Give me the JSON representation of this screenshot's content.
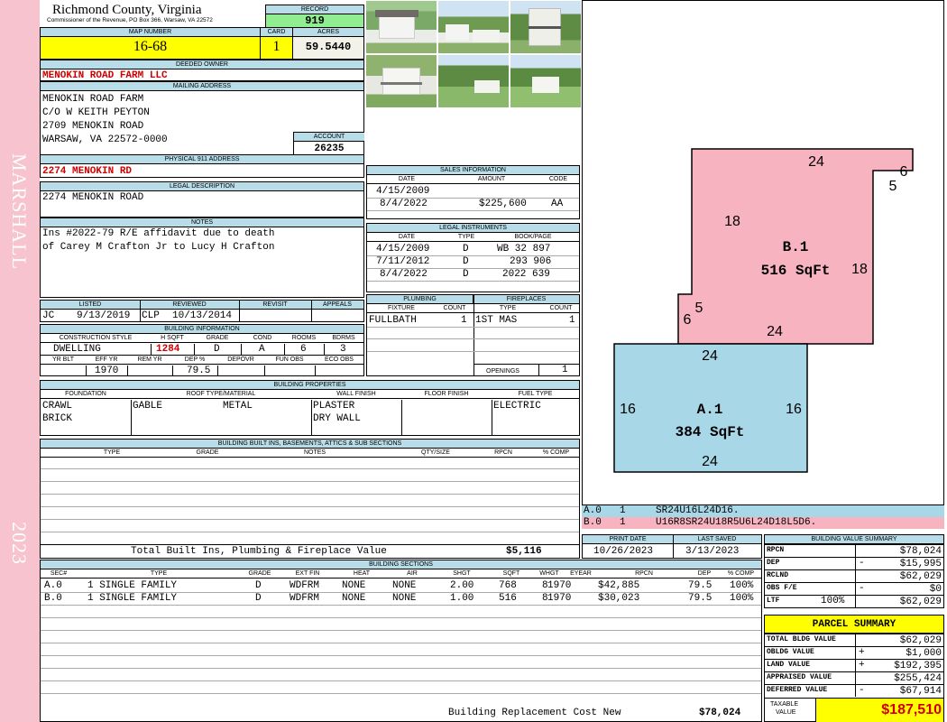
{
  "side": {
    "district": "MARSHALL",
    "year": "2023"
  },
  "header": {
    "county": "Richmond County, Virginia",
    "commissioner": "Commissioner of the Revenue, PO Box 366, Warsaw, VA 22572",
    "record_label": "RECORD",
    "record": "919",
    "map_label": "MAP NUMBER",
    "map": "16-68",
    "card_label": "CARD",
    "card": "1",
    "acres_label": "ACRES",
    "acres": "59.5440"
  },
  "owner": {
    "deeded_label": "DEEDED OWNER",
    "deeded": "MENOKIN ROAD FARM LLC",
    "mailing_label": "MAILING ADDRESS",
    "lines": [
      "MENOKIN ROAD FARM",
      "C/O W KEITH PEYTON",
      "2709 MENOKIN ROAD",
      "WARSAW, VA 22572-0000"
    ],
    "account_label": "ACCOUNT",
    "account": "26235"
  },
  "physical": {
    "label": "PHYSICAL 911 ADDRESS",
    "value": "2274 MENOKIN RD"
  },
  "legal": {
    "label": "LEGAL DESCRIPTION",
    "value": "2274 MENOKIN ROAD"
  },
  "notes": {
    "label": "NOTES",
    "lines": [
      "Ins #2022-79 R/E affidavit due to death",
      "of Carey M Crafton Jr to Lucy H Crafton"
    ]
  },
  "sales": {
    "label": "SALES INFORMATION",
    "cols": [
      "DATE",
      "AMOUNT",
      "CODE"
    ],
    "rows": [
      {
        "date": "4/15/2009",
        "amount": "",
        "code": ""
      },
      {
        "date": "8/4/2022",
        "amount": "$225,600",
        "code": "AA"
      }
    ]
  },
  "instruments": {
    "label": "LEGAL INSTRUMENTS",
    "cols": [
      "DATE",
      "TYPE",
      "BOOK/PAGE"
    ],
    "rows": [
      {
        "date": "4/15/2009",
        "type": "D",
        "book": "WB 32 897"
      },
      {
        "date": "7/11/2012",
        "type": "D",
        "book": "293 906"
      },
      {
        "date": "8/4/2022",
        "type": "D",
        "book": "2022 639"
      }
    ]
  },
  "review": {
    "cols": [
      "LISTED",
      "REVIEWED",
      "REVISIT",
      "APPEALS"
    ],
    "listed_by": "JC",
    "listed": "9/13/2019",
    "reviewed_by": "CLP",
    "reviewed": "10/13/2014"
  },
  "bldg_info": {
    "label": "BUILDING INFORMATION",
    "cols": [
      "CONSTRUCTION STYLE",
      "H SQFT",
      "GRADE",
      "COND",
      "ROOMS",
      "BDRMS"
    ],
    "style": "DWELLING",
    "hsqft": "1284",
    "grade": "D",
    "cond": "A",
    "rooms": "6",
    "bdrms": "3",
    "cols2": [
      "YR BLT",
      "EFF YR",
      "REM YR",
      "DEP %",
      "DEPOVR",
      "FUN OBS",
      "ECO OBS"
    ],
    "eff_yr": "1970",
    "dep": "79.5"
  },
  "plumbing": {
    "label": "PLUMBING",
    "cols": [
      "FIXTURE",
      "COUNT"
    ],
    "fixture": "FULLBATH",
    "count": "1"
  },
  "fireplaces": {
    "label": "FIREPLACES",
    "cols": [
      "TYPE",
      "COUNT"
    ],
    "type": "1ST MAS",
    "count": "1",
    "openings_label": "OPENINGS",
    "openings": "1"
  },
  "props": {
    "label": "BUILDING PROPERTIES",
    "cols": [
      "FOUNDATION",
      "ROOF TYPE/MATERIAL",
      "WALL FINISH",
      "FLOOR FINISH",
      "FUEL TYPE"
    ],
    "foundation": [
      "CRAWL",
      "BRICK"
    ],
    "roof_type": "GABLE",
    "roof_mat": "METAL",
    "wall": [
      "PLASTER",
      "DRY WALL"
    ],
    "fuel": "ELECTRIC"
  },
  "builtins": {
    "label": "BUILDING BUILT INS, BASEMENTS, ATTICS & SUB SECTIONS",
    "cols": [
      "TYPE",
      "GRADE",
      "NOTES",
      "QTY/SIZE",
      "RPCN",
      "% COMP"
    ],
    "total_label": "Total Built Ins, Plumbing & Fireplace Value",
    "total": "$5,116"
  },
  "sections": {
    "label": "BUILDING SECTIONS",
    "cols": [
      "SEC#",
      "TYPE",
      "GRADE",
      "EXT FIN",
      "HEAT",
      "AIR",
      "SHGT",
      "SQFT",
      "WHGT",
      "EYEAR",
      "RPCN",
      "DEP",
      "% COMP"
    ],
    "rows": [
      {
        "sec": "A.0",
        "type": "1 SINGLE FAMILY",
        "grade": "D",
        "ext": "WDFRM",
        "heat": "NONE",
        "air": "NONE",
        "shgt": "2.00",
        "sqft": "768",
        "whgt": "8",
        "eyear": "1970",
        "rpcn": "$42,885",
        "dep": "79.5",
        "comp": "100%"
      },
      {
        "sec": "B.0",
        "type": "1 SINGLE FAMILY",
        "grade": "D",
        "ext": "WDFRM",
        "heat": "NONE",
        "air": "NONE",
        "shgt": "1.00",
        "sqft": "516",
        "whgt": "8",
        "eyear": "1970",
        "rpcn": "$30,023",
        "dep": "79.5",
        "comp": "100%"
      }
    ],
    "replacement_label": "Building Replacement Cost New",
    "replacement": "$78,024"
  },
  "sketch": {
    "b_label": "B.1",
    "b_area": "516 SqFt",
    "a_label": "A.1",
    "a_area": "384 SqFt",
    "b_dims": [
      "24",
      "6",
      "5",
      "18",
      "18",
      "5",
      "6",
      "24"
    ],
    "a_dims": [
      "24",
      "16",
      "16",
      "24"
    ],
    "codes": [
      {
        "sec": "A.0",
        "n": "1",
        "code": "SR24U16L24D16."
      },
      {
        "sec": "B.0",
        "n": "1",
        "code": "U16R8SR24U18R5U6L24D18L5D6."
      }
    ]
  },
  "dates": {
    "print_label": "PRINT DATE",
    "print": "10/26/2023",
    "saved_label": "LAST SAVED",
    "saved": "3/13/2023"
  },
  "bvs": {
    "label": "BUILDING VALUE SUMMARY",
    "rows": [
      {
        "k": "RPCN",
        "s": "",
        "v": "$78,024"
      },
      {
        "k": "DEP",
        "s": "-",
        "v": "$15,995"
      },
      {
        "k": "RCLND",
        "s": "",
        "v": "$62,029"
      },
      {
        "k": "OBS F/E",
        "s": "-",
        "v": "$0"
      },
      {
        "k": "LTF",
        "s": "100%",
        "v": "$62,029"
      }
    ]
  },
  "parcel": {
    "label": "PARCEL SUMMARY",
    "rows": [
      {
        "k": "TOTAL BLDG VALUE",
        "s": "",
        "v": "$62,029"
      },
      {
        "k": "OBLDG VALUE",
        "s": "+",
        "v": "$1,000"
      },
      {
        "k": "LAND VALUE",
        "s": "+",
        "v": "$192,395"
      },
      {
        "k": "APPRAISED VALUE",
        "s": "",
        "v": "$255,424"
      },
      {
        "k": "DEFERRED VALUE",
        "s": "-",
        "v": "$67,914"
      }
    ],
    "taxable_label": [
      "TAXABLE",
      "VALUE"
    ],
    "taxable": "$187,510"
  },
  "colors": {
    "side": "#f7c3cf",
    "header": "#b8dde8",
    "yellow": "#ffff00",
    "green": "#90ee90",
    "pink_sketch": "#f7b4c0",
    "blue_sketch": "#a8d8e8",
    "red_text": "#d00000"
  }
}
